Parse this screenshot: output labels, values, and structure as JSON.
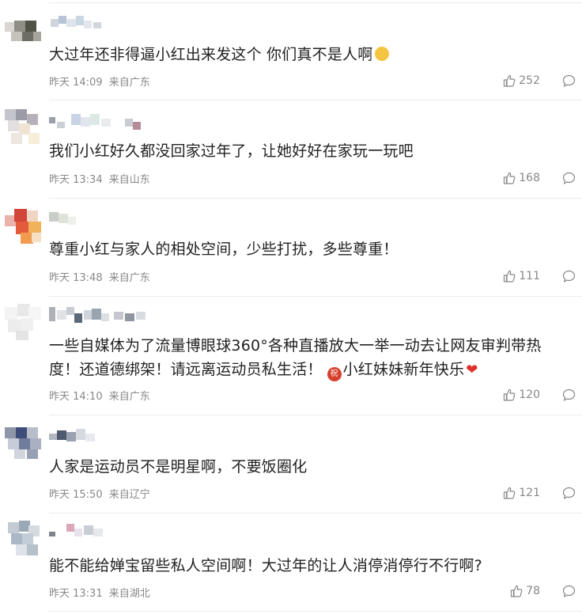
{
  "colors": {
    "text": "#222222",
    "meta": "#888888",
    "divider": "#ececec"
  },
  "comments": [
    {
      "text": "大过年还非得逼小红出来发这个 你们真不是人啊",
      "emoji": "smile-emoji",
      "time": "昨天 14:09",
      "location": "来自广东",
      "likes": "252"
    },
    {
      "text": "我们小红好久都没回家过年了，让她好好在家玩一玩吧",
      "time": "昨天 13:34",
      "location": "来自山东",
      "likes": "168"
    },
    {
      "text": "尊重小红与家人的相处空间，少些打扰，多些尊重！",
      "time": "昨天 13:48",
      "location": "来自广东",
      "likes": "111"
    },
    {
      "text_line1": "一些自媒体为了流量博眼球360°各种直播放大一举一动去让网友审判带热",
      "text_line2": "度！还道德绑架！请远离运动员私生活！",
      "blessing_glyph": "祝",
      "text_tail": "小红妹妹新年快乐",
      "emoji": "heart-emoji",
      "time": "昨天 14:10",
      "location": "来自广东",
      "likes": "120"
    },
    {
      "text": "人家是运动员不是明星啊，不要饭圈化",
      "time": "昨天 15:50",
      "location": "来自辽宁",
      "likes": "121"
    },
    {
      "text": "能不能给婵宝留些私人空间啊！大过年的让人消停消停行不行啊?",
      "time": "昨天 13:31",
      "location": "来自湖北",
      "likes": "78"
    }
  ]
}
